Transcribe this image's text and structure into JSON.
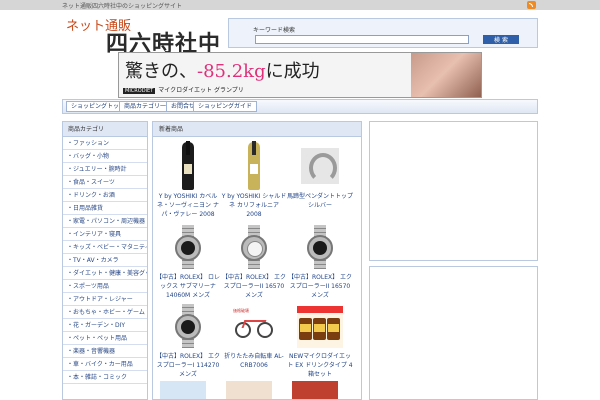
{
  "topbar": {
    "tagline": "ネット通販四六時社中のショッピングサイト",
    "rss_icon": "rss-icon"
  },
  "logo": {
    "small": "ネット通販",
    "big": "四六時社中"
  },
  "search": {
    "label": "キーワード検索",
    "value": "",
    "placeholder": "",
    "button": "検 索"
  },
  "banner": {
    "headline_pre": "驚きの、",
    "headline_num": "-85.2kg",
    "headline_post": "に成功",
    "brand": "MICRODIET",
    "subtitle": "マイクロダイエット グランプリ"
  },
  "nav": {
    "items": [
      {
        "label": "ショッピングトップ"
      },
      {
        "label": "商品カテゴリ一覧"
      },
      {
        "label": "お問合せ"
      },
      {
        "label": "ショッピングガイド"
      }
    ]
  },
  "sidebar": {
    "title": "商品カテゴリ",
    "items": [
      {
        "label": "・ファッション"
      },
      {
        "label": "・バッグ・小物"
      },
      {
        "label": "・ジュエリー・腕時計"
      },
      {
        "label": "・食品・スイーツ"
      },
      {
        "label": "・ドリンク・お酒"
      },
      {
        "label": "・日用品雑貨"
      },
      {
        "label": "・家電・パソコン・周辺機器"
      },
      {
        "label": "・インテリア・寝具"
      },
      {
        "label": "・キッズ・ベビー・マタニティ"
      },
      {
        "label": "・TV・AV・カメラ"
      },
      {
        "label": "・ダイエット・健康・美容グッズ"
      },
      {
        "label": "・スポーツ用品"
      },
      {
        "label": "・アウトドア・レジャー"
      },
      {
        "label": "・おもちゃ・ホビー・ゲーム"
      },
      {
        "label": "・花・ガーデン・DIY"
      },
      {
        "label": "・ペット・ペット用品"
      },
      {
        "label": "・楽器・音響機器"
      },
      {
        "label": "・車・バイク・カー用品"
      },
      {
        "label": "・本・雑誌・コミック"
      }
    ]
  },
  "main": {
    "title": "新着商品",
    "products": [
      {
        "caption": "Y by YOSHIKI カベルネ・ソーヴィニヨン ナパ・ヴァレー 2008",
        "thumb": "bottle-dark"
      },
      {
        "caption": "Y by YOSHIKI シャルドネ カリフォルニア 2008",
        "thumb": "bottle-white"
      },
      {
        "caption": "馬蹄型ペンダントトップ シルバー",
        "thumb": "horseshoe"
      },
      {
        "caption": "【中古】ROLEX】 ロレックス サブマリーナ 14060M メンズ",
        "thumb": "watch-black"
      },
      {
        "caption": "【中古】ROLEX】 エクスプローラーII 16570 メンズ",
        "thumb": "watch-white"
      },
      {
        "caption": "【中古】ROLEX】 エクスプローラーII 16570 メンズ",
        "thumb": "watch-black"
      },
      {
        "caption": "【中古】ROLEX】 エクスプローラーI 114270 メンズ",
        "thumb": "watch-black"
      },
      {
        "caption": "折りたたみ自転車 AL-CRB7006",
        "thumb": "bike"
      },
      {
        "caption": "NEWマイクロダイエット EX ドリンクタイプ 4箱セット",
        "thumb": "jars"
      }
    ],
    "bike_tag": "価格破壊",
    "jars_band": "大特価"
  }
}
